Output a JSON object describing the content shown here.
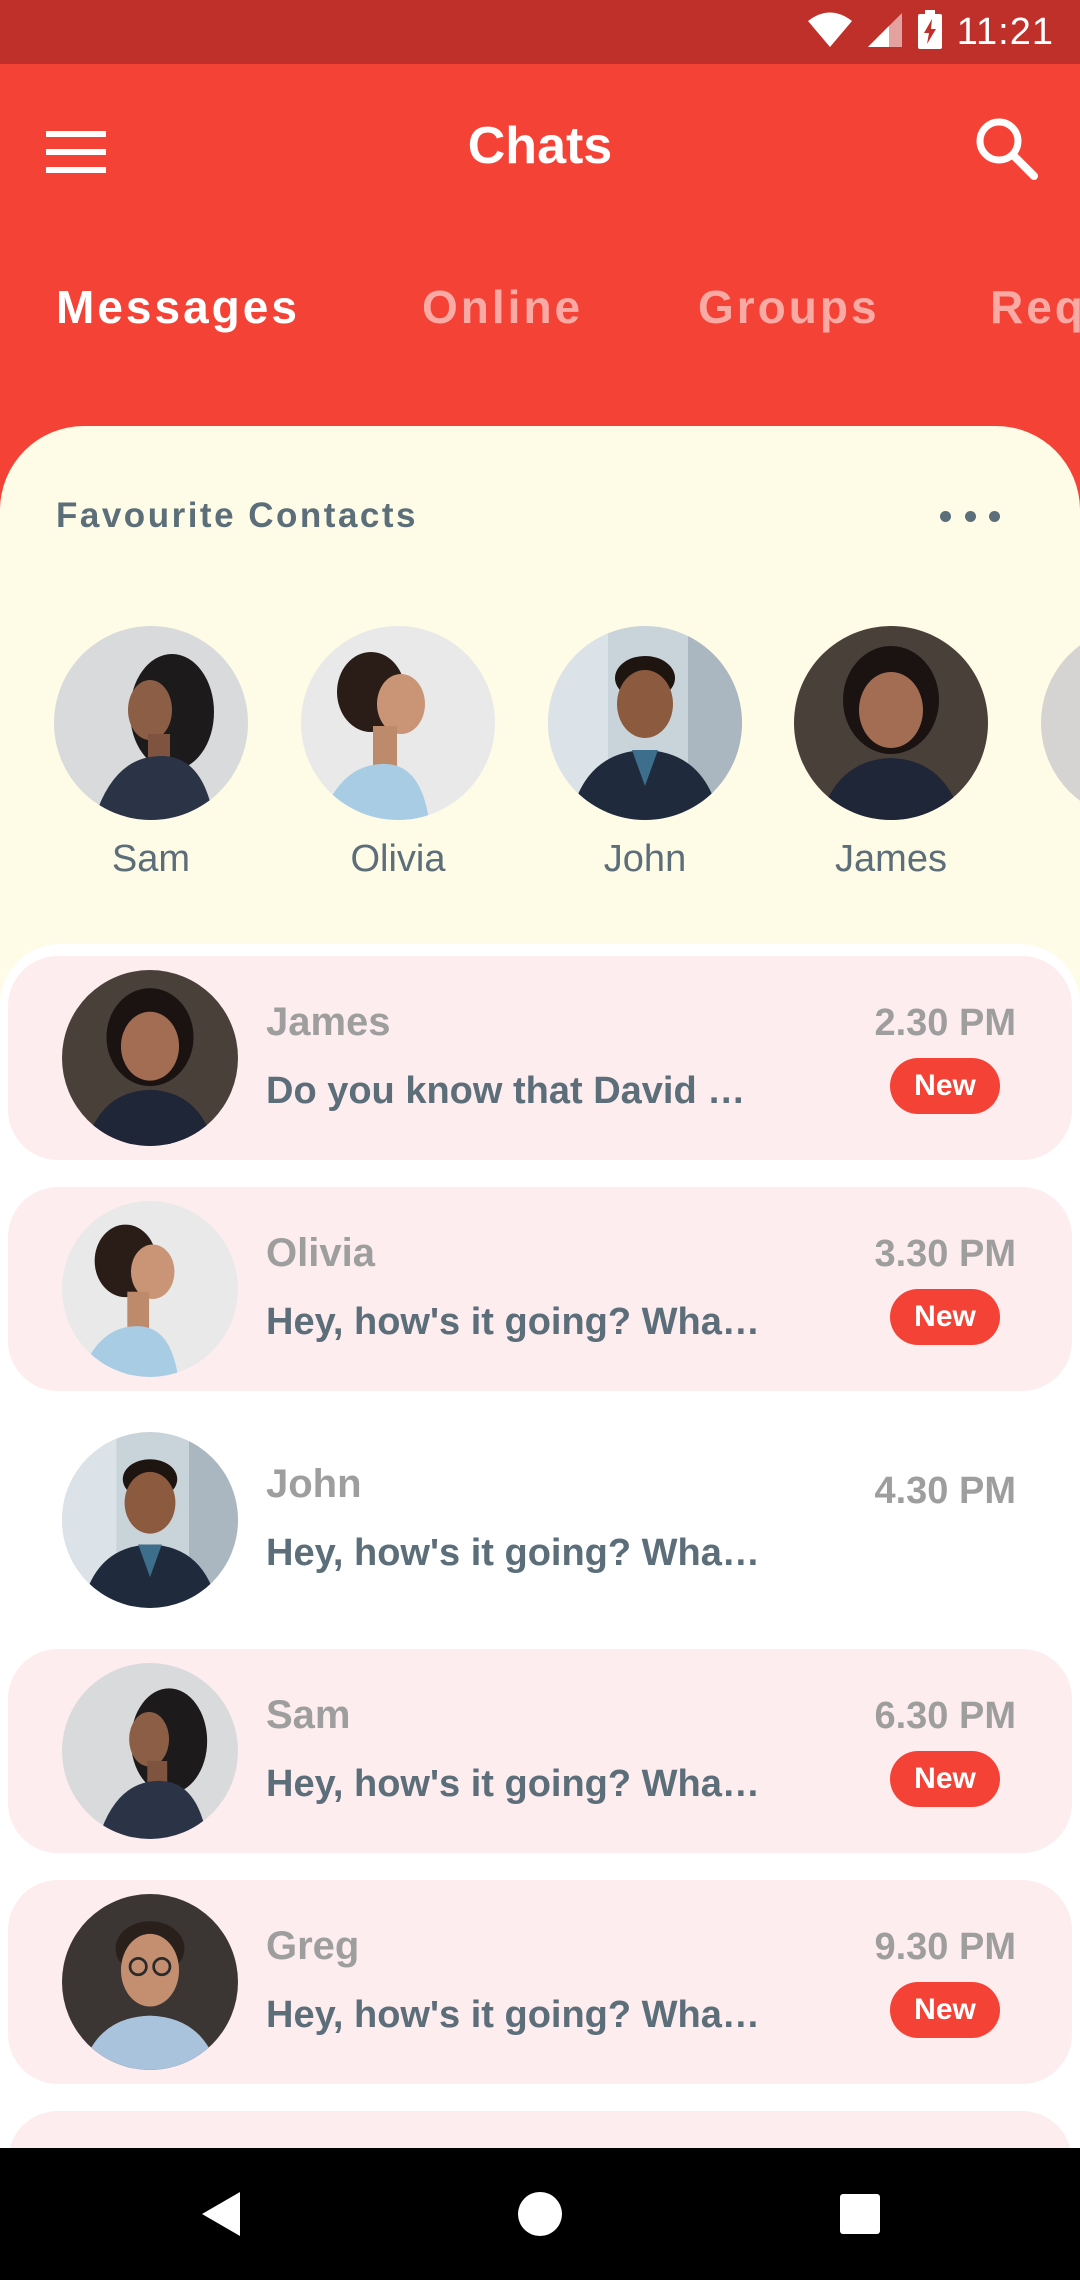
{
  "status_bar": {
    "time": "11:21",
    "icons": [
      "wifi-icon",
      "signal-icon",
      "battery-charging-icon"
    ]
  },
  "app_bar": {
    "title": "Chats",
    "menu_icon": "menu-icon",
    "search_icon": "search-icon"
  },
  "tabs": [
    {
      "label": "Messages",
      "active": true
    },
    {
      "label": "Online",
      "active": false
    },
    {
      "label": "Groups",
      "active": false
    },
    {
      "label": "Requests",
      "active": false
    }
  ],
  "favorites": {
    "title": "Favourite Contacts",
    "more_icon": "more-horizontal-icon",
    "contacts": [
      {
        "name": "Sam"
      },
      {
        "name": "Olivia"
      },
      {
        "name": "John"
      },
      {
        "name": "James"
      }
    ]
  },
  "chats": [
    {
      "name": "James",
      "message": "Do you know that David w...",
      "time": "2.30 PM",
      "unread": true,
      "badge": "New"
    },
    {
      "name": "Olivia",
      "message": "Hey, how's it going? What ...",
      "time": "3.30 PM",
      "unread": true,
      "badge": "New"
    },
    {
      "name": "John",
      "message": "Hey, how's it going? What ...",
      "time": "4.30 PM",
      "unread": false,
      "badge": ""
    },
    {
      "name": "Sam",
      "message": "Hey, how's it going? What ...",
      "time": "6.30 PM",
      "unread": true,
      "badge": "New"
    },
    {
      "name": "Greg",
      "message": "Hey, how's it going? What ...",
      "time": "9.30 PM",
      "unread": true,
      "badge": "New"
    }
  ],
  "colors": {
    "primary": "#F44336",
    "status_bar": "#C0302A",
    "favorites_bg": "#FEFBE6",
    "unread_bg": "#FEEDEE",
    "text_secondary": "#5B6E7A"
  },
  "nav_bar": {
    "icons": [
      "back-icon",
      "home-icon",
      "recents-icon"
    ]
  }
}
